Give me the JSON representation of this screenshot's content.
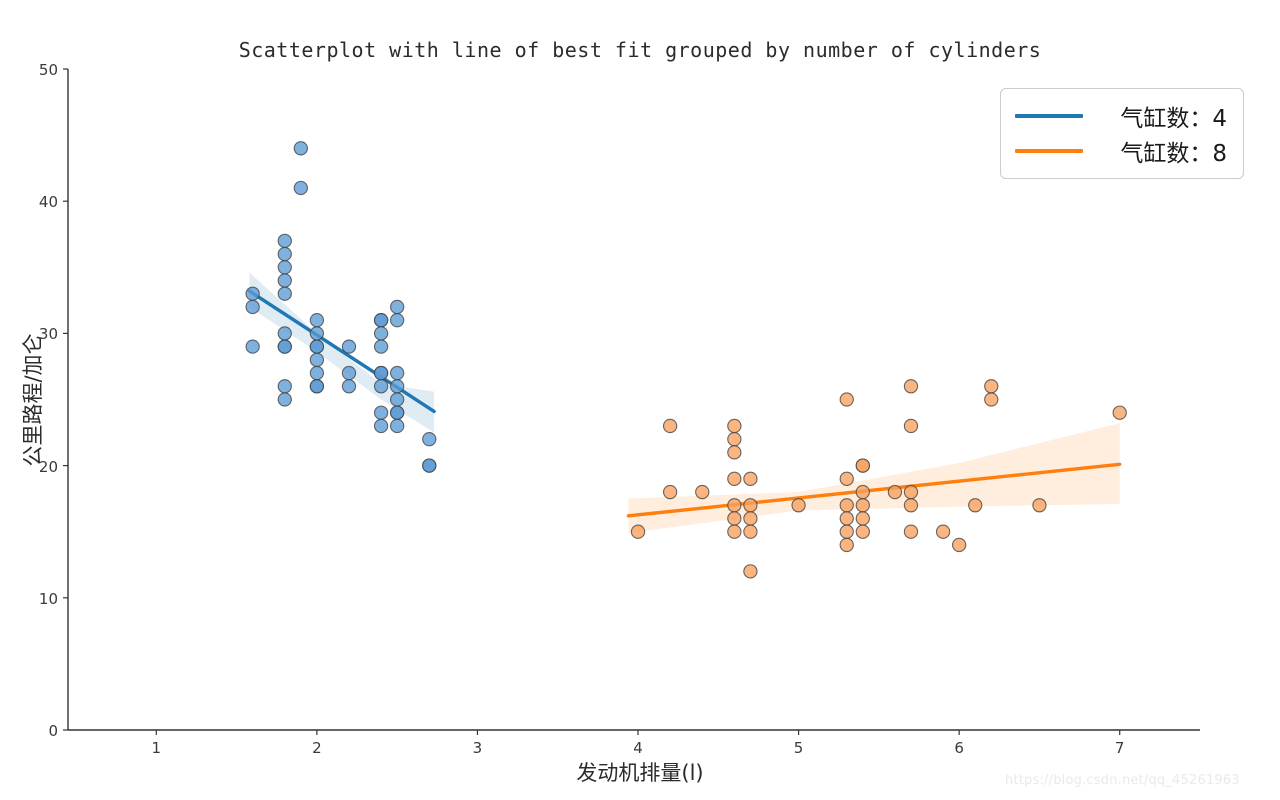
{
  "chart_data": {
    "type": "scatter",
    "title": "Scatterplot with line of best fit grouped by number of cylinders",
    "xlabel": "发动机排量(l)",
    "ylabel": "公里路程/加仑",
    "xlim": [
      0.45,
      7.5
    ],
    "ylim": [
      0,
      50
    ],
    "xticks": [
      "1",
      "2",
      "3",
      "4",
      "5",
      "6",
      "7"
    ],
    "xtick_values": [
      1,
      2,
      3,
      4,
      5,
      6,
      7
    ],
    "yticks": [
      "0",
      "10",
      "20",
      "30",
      "40",
      "50"
    ],
    "ytick_values": [
      0,
      10,
      20,
      30,
      40,
      50
    ],
    "grid": false,
    "legend_position": "top-right",
    "watermark": "https://blog.csdn.net/qq_45261963",
    "series": [
      {
        "name": "气缸数：4",
        "color": "#1f77b4",
        "marker_fill": "#5b9bd5",
        "marker_edge": "#444444",
        "points": [
          [
            1.6,
            33.0
          ],
          [
            1.6,
            32.0
          ],
          [
            1.6,
            29.0
          ],
          [
            1.8,
            37.0
          ],
          [
            1.8,
            36.0
          ],
          [
            1.8,
            35.0
          ],
          [
            1.8,
            34.0
          ],
          [
            1.8,
            33.0
          ],
          [
            1.8,
            30.0
          ],
          [
            1.8,
            29.0
          ],
          [
            1.8,
            29.0
          ],
          [
            1.8,
            26.0
          ],
          [
            1.8,
            25.0
          ],
          [
            1.9,
            44.0
          ],
          [
            1.9,
            41.0
          ],
          [
            2.0,
            31.0
          ],
          [
            2.0,
            30.0
          ],
          [
            2.0,
            29.0
          ],
          [
            2.0,
            29.0
          ],
          [
            2.0,
            28.0
          ],
          [
            2.0,
            27.0
          ],
          [
            2.0,
            26.0
          ],
          [
            2.0,
            26.0
          ],
          [
            2.2,
            29.0
          ],
          [
            2.2,
            27.0
          ],
          [
            2.2,
            26.0
          ],
          [
            2.4,
            31.0
          ],
          [
            2.4,
            31.0
          ],
          [
            2.4,
            30.0
          ],
          [
            2.4,
            29.0
          ],
          [
            2.4,
            27.0
          ],
          [
            2.4,
            27.0
          ],
          [
            2.4,
            26.0
          ],
          [
            2.4,
            24.0
          ],
          [
            2.4,
            23.0
          ],
          [
            2.5,
            32.0
          ],
          [
            2.5,
            31.0
          ],
          [
            2.5,
            27.0
          ],
          [
            2.5,
            26.0
          ],
          [
            2.5,
            25.0
          ],
          [
            2.5,
            24.0
          ],
          [
            2.5,
            24.0
          ],
          [
            2.5,
            23.0
          ],
          [
            2.7,
            22.0
          ],
          [
            2.7,
            20.0
          ],
          [
            2.7,
            20.0
          ]
        ],
        "fit_line": {
          "x0": 1.58,
          "y0": 33.2,
          "x1": 2.73,
          "y1": 24.1
        },
        "band": {
          "upper": [
            [
              1.58,
              34.6
            ],
            [
              2.0,
              30.0
            ],
            [
              2.4,
              26.2
            ],
            [
              2.73,
              25.6
            ]
          ],
          "lower": [
            [
              1.58,
              32.0
            ],
            [
              2.0,
              28.6
            ],
            [
              2.4,
              25.0
            ],
            [
              2.73,
              22.5
            ]
          ]
        }
      },
      {
        "name": "气缸数：8",
        "color": "#ff7f0e",
        "marker_fill": "#f9a05c",
        "marker_edge": "#444444",
        "points": [
          [
            4.0,
            15.0
          ],
          [
            4.2,
            23.0
          ],
          [
            4.2,
            18.0
          ],
          [
            4.4,
            18.0
          ],
          [
            4.6,
            23.0
          ],
          [
            4.6,
            22.0
          ],
          [
            4.6,
            21.0
          ],
          [
            4.6,
            19.0
          ],
          [
            4.6,
            17.0
          ],
          [
            4.6,
            16.0
          ],
          [
            4.6,
            15.0
          ],
          [
            4.7,
            19.0
          ],
          [
            4.7,
            17.0
          ],
          [
            4.7,
            16.0
          ],
          [
            4.7,
            15.0
          ],
          [
            4.7,
            12.0
          ],
          [
            5.0,
            17.0
          ],
          [
            5.3,
            25.0
          ],
          [
            5.3,
            19.0
          ],
          [
            5.3,
            17.0
          ],
          [
            5.3,
            16.0
          ],
          [
            5.3,
            15.0
          ],
          [
            5.3,
            14.0
          ],
          [
            5.4,
            20.0
          ],
          [
            5.4,
            20.0
          ],
          [
            5.4,
            18.0
          ],
          [
            5.4,
            17.0
          ],
          [
            5.4,
            16.0
          ],
          [
            5.4,
            15.0
          ],
          [
            5.6,
            18.0
          ],
          [
            5.7,
            26.0
          ],
          [
            5.7,
            23.0
          ],
          [
            5.7,
            18.0
          ],
          [
            5.7,
            17.0
          ],
          [
            5.7,
            15.0
          ],
          [
            5.9,
            15.0
          ],
          [
            6.0,
            14.0
          ],
          [
            6.1,
            17.0
          ],
          [
            6.2,
            26.0
          ],
          [
            6.2,
            25.0
          ],
          [
            6.5,
            17.0
          ],
          [
            7.0,
            24.0
          ]
        ],
        "fit_line": {
          "x0": 3.94,
          "y0": 16.2,
          "x1": 7.0,
          "y1": 20.1
        },
        "band": {
          "upper": [
            [
              3.94,
              17.5
            ],
            [
              5.0,
              18.0
            ],
            [
              6.0,
              20.2
            ],
            [
              7.0,
              23.2
            ]
          ],
          "lower": [
            [
              3.94,
              14.9
            ],
            [
              5.0,
              16.6
            ],
            [
              6.0,
              16.9
            ],
            [
              7.0,
              17.1
            ]
          ]
        }
      }
    ]
  },
  "axes": {
    "title": "Scatterplot with line of best fit grouped by number of cylinders",
    "xlabel": "发动机排量(l)",
    "ylabel": "公里路程/加仑"
  },
  "legend": {
    "entries": [
      {
        "label": "气缸数：4",
        "color": "#1f77b4"
      },
      {
        "label": "气缸数：8",
        "color": "#ff7f0e"
      }
    ]
  },
  "watermark": {
    "text": "https://blog.csdn.net/qq_45261963"
  },
  "colors": {
    "blue": "#1f77b4",
    "orange": "#ff7f0e",
    "blue_marker": "#5b9bd5",
    "orange_marker": "#f9a05c",
    "axis": "#333333",
    "text": "#2b2b2b"
  }
}
